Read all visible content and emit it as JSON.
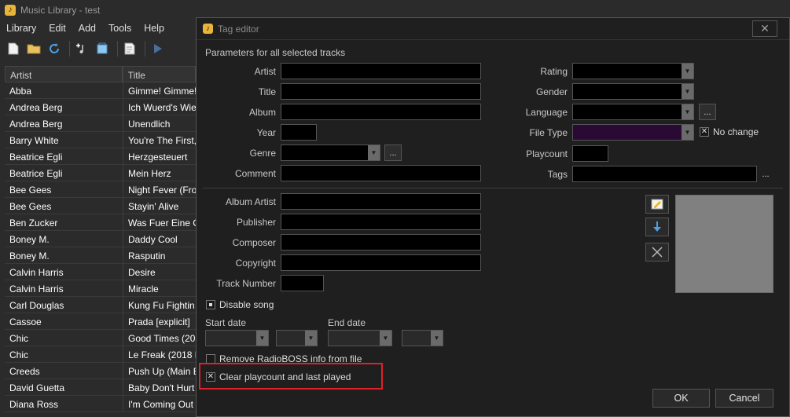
{
  "main": {
    "title": "Music Library - test",
    "menu": [
      "Library",
      "Edit",
      "Add",
      "Tools",
      "Help"
    ],
    "columns": [
      "Artist",
      "Title"
    ],
    "rows": [
      [
        "Abba",
        "Gimme! Gimme!"
      ],
      [
        "Andrea Berg",
        "Ich Wuerd's Wie"
      ],
      [
        "Andrea Berg",
        "Unendlich"
      ],
      [
        "Barry White",
        "You're The First,"
      ],
      [
        "Beatrice Egli",
        "Herzgesteuert"
      ],
      [
        "Beatrice Egli",
        "Mein Herz"
      ],
      [
        "Bee Gees",
        "Night Fever (Fro"
      ],
      [
        "Bee Gees",
        "Stayin' Alive"
      ],
      [
        "Ben Zucker",
        "Was Fuer Eine G"
      ],
      [
        "Boney M.",
        "Daddy Cool"
      ],
      [
        "Boney M.",
        "Rasputin"
      ],
      [
        "Calvin Harris",
        "Desire"
      ],
      [
        "Calvin Harris",
        "Miracle"
      ],
      [
        "Carl Douglas",
        "Kung Fu Fightin"
      ],
      [
        "Cassoe",
        "Prada [explicit]"
      ],
      [
        "Chic",
        "Good Times (201"
      ],
      [
        "Chic",
        "Le Freak (2018 R"
      ],
      [
        "Creeds",
        "Push Up (Main E"
      ],
      [
        "David Guetta",
        "Baby Don't Hurt"
      ],
      [
        "Diana Ross",
        "I'm Coming Out"
      ]
    ]
  },
  "dialog": {
    "title": "Tag editor",
    "close_glyph": "✕",
    "section_label": "Parameters for all selected tracks",
    "left_fields": {
      "artist": "Artist",
      "title": "Title",
      "album": "Album",
      "year": "Year",
      "genre": "Genre",
      "comment": "Comment"
    },
    "right_fields": {
      "rating": "Rating",
      "gender": "Gender",
      "language": "Language",
      "file_type": "File Type",
      "playcount": "Playcount",
      "tags": "Tags",
      "no_change": "No change"
    },
    "lower_fields": {
      "album_artist": "Album Artist",
      "publisher": "Publisher",
      "composer": "Composer",
      "copyright": "Copyright",
      "track_number": "Track Number"
    },
    "ellipsis": "...",
    "disable_song": "Disable song",
    "start_date": "Start date",
    "end_date": "End date",
    "remove_info": "Remove RadioBOSS info from file",
    "clear_playcount": "Clear playcount and last played",
    "ok": "OK",
    "cancel": "Cancel"
  },
  "colors": {
    "highlight": "#e0202a",
    "file_type_bg": "#2a0a35",
    "art_bg": "#808080"
  }
}
